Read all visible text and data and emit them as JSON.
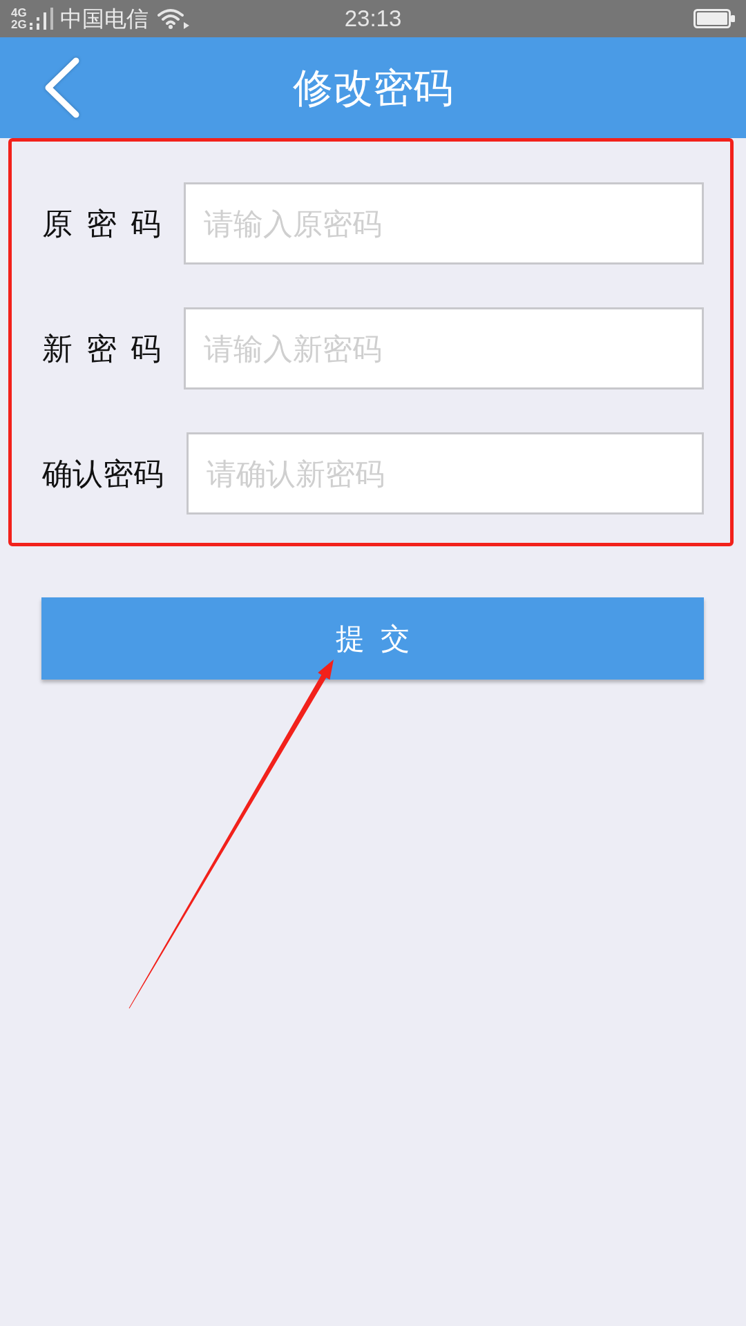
{
  "status_bar": {
    "network_top": "4G",
    "network_bottom": "2G",
    "carrier": "中国电信",
    "time": "23:13"
  },
  "header": {
    "title": "修改密码"
  },
  "form": {
    "highlighted": true,
    "fields": [
      {
        "label": "原 密 码",
        "placeholder": "请输入原密码"
      },
      {
        "label": "新 密 码",
        "placeholder": "请输入新密码"
      },
      {
        "label": "确认密码",
        "placeholder": "请确认新密码"
      }
    ]
  },
  "submit_button": {
    "label": "提 交",
    "pointed_at": true
  }
}
